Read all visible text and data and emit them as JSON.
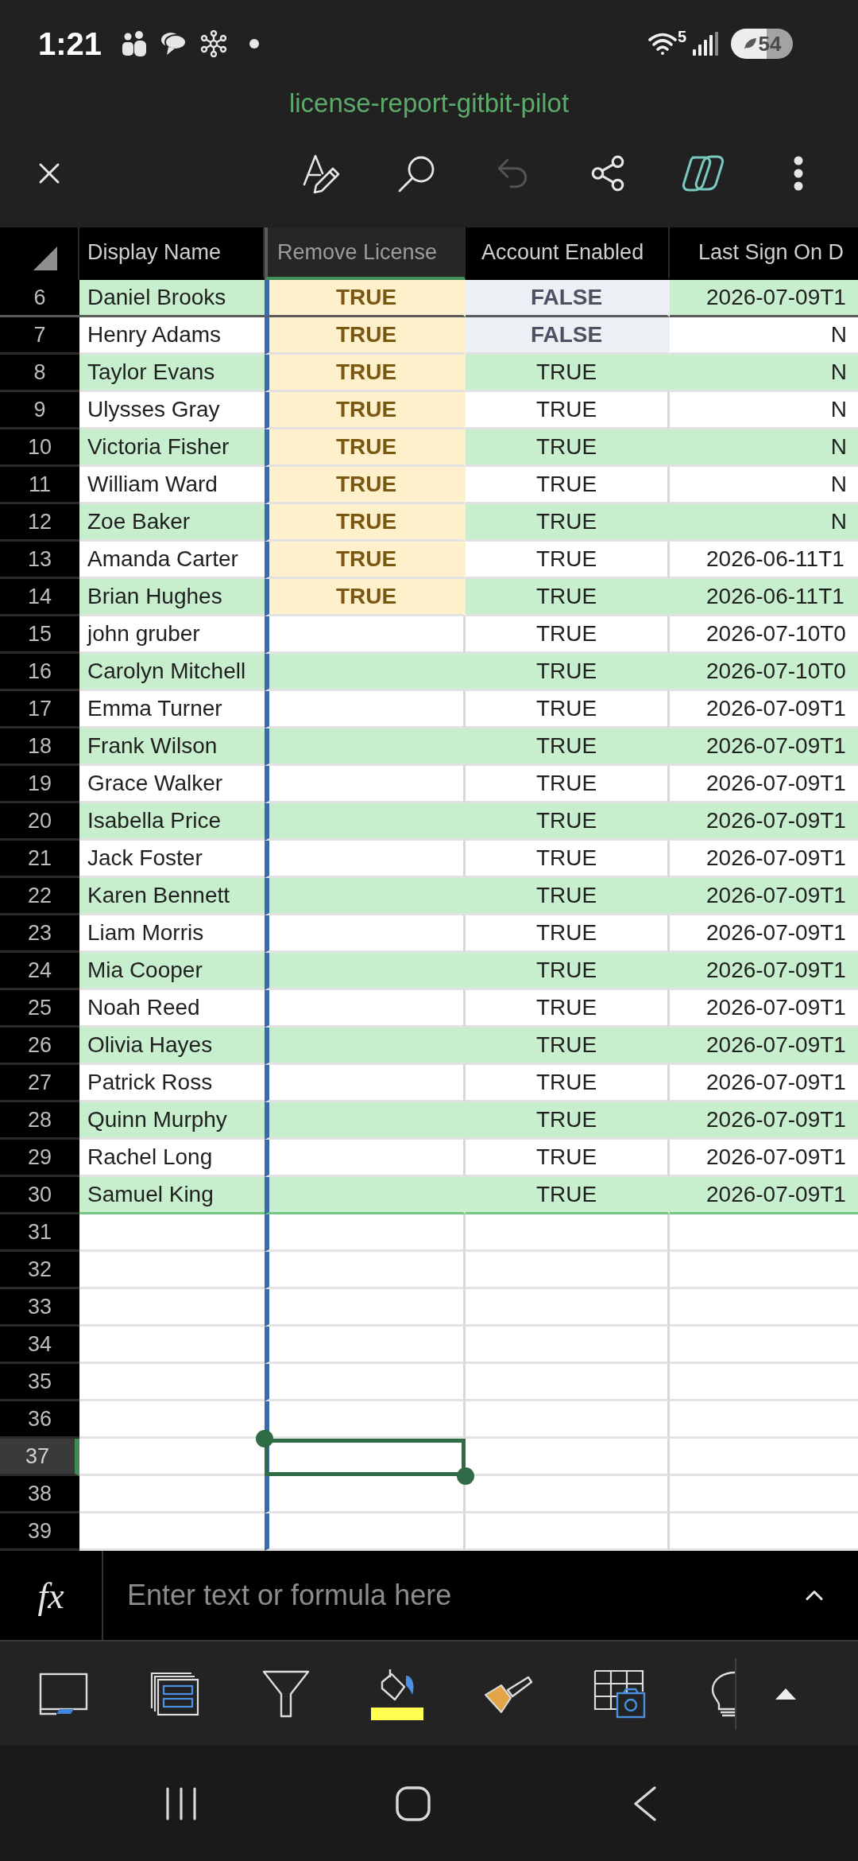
{
  "status_bar": {
    "time": "1:21",
    "wifi_label": "5",
    "battery": "54"
  },
  "title": "license-report-gitbit-pilot",
  "toolbar": [
    {
      "kind": "edit",
      "disabled": false
    },
    {
      "kind": "search",
      "disabled": false
    },
    {
      "kind": "undo",
      "disabled": true
    },
    {
      "kind": "share",
      "disabled": false
    },
    {
      "kind": "assistant",
      "disabled": false
    },
    {
      "kind": "more",
      "disabled": false
    }
  ],
  "table": {
    "columns": [
      {
        "label": "Display Name",
        "selected": false
      },
      {
        "label": "Remove License",
        "selected": true
      },
      {
        "label": "Account Enabled",
        "selected": false
      },
      {
        "label": "Last Sign On D",
        "selected": false
      }
    ],
    "frozen_rows": [
      {
        "number": "6",
        "selected": false,
        "banded": true,
        "cells": [
          {
            "text": "Daniel Brooks",
            "kind": "name"
          },
          {
            "text": "TRUE",
            "kind": "highlight"
          },
          {
            "text": "FALSE",
            "kind": "muted"
          },
          {
            "text": "2026-07-09T1",
            "kind": "date"
          }
        ]
      }
    ],
    "rows": [
      {
        "number": "7",
        "selected": false,
        "banded": false,
        "cells": [
          {
            "text": "Henry Adams",
            "kind": "name"
          },
          {
            "text": "TRUE",
            "kind": "highlight"
          },
          {
            "text": "FALSE",
            "kind": "muted"
          },
          {
            "text": "N",
            "kind": "status"
          }
        ]
      },
      {
        "number": "8",
        "selected": false,
        "banded": true,
        "cells": [
          {
            "text": "Taylor Evans",
            "kind": "name"
          },
          {
            "text": "TRUE",
            "kind": "highlight"
          },
          {
            "text": "TRUE",
            "kind": "bool"
          },
          {
            "text": "N",
            "kind": "status"
          }
        ]
      },
      {
        "number": "9",
        "selected": false,
        "banded": false,
        "cells": [
          {
            "text": "Ulysses Gray",
            "kind": "name"
          },
          {
            "text": "TRUE",
            "kind": "highlight"
          },
          {
            "text": "TRUE",
            "kind": "bool"
          },
          {
            "text": "N",
            "kind": "status"
          }
        ]
      },
      {
        "number": "10",
        "selected": false,
        "banded": true,
        "cells": [
          {
            "text": "Victoria Fisher",
            "kind": "name"
          },
          {
            "text": "TRUE",
            "kind": "highlight"
          },
          {
            "text": "TRUE",
            "kind": "bool"
          },
          {
            "text": "N",
            "kind": "status"
          }
        ]
      },
      {
        "number": "11",
        "selected": false,
        "banded": false,
        "cells": [
          {
            "text": "William Ward",
            "kind": "name"
          },
          {
            "text": "TRUE",
            "kind": "highlight"
          },
          {
            "text": "TRUE",
            "kind": "bool"
          },
          {
            "text": "N",
            "kind": "status"
          }
        ]
      },
      {
        "number": "12",
        "selected": false,
        "banded": true,
        "cells": [
          {
            "text": "Zoe Baker",
            "kind": "name"
          },
          {
            "text": "TRUE",
            "kind": "highlight"
          },
          {
            "text": "TRUE",
            "kind": "bool"
          },
          {
            "text": "N",
            "kind": "status"
          }
        ]
      },
      {
        "number": "13",
        "selected": false,
        "banded": false,
        "cells": [
          {
            "text": "Amanda Carter",
            "kind": "name"
          },
          {
            "text": "TRUE",
            "kind": "highlight"
          },
          {
            "text": "TRUE",
            "kind": "bool"
          },
          {
            "text": "2026-06-11T1",
            "kind": "date"
          }
        ]
      },
      {
        "number": "14",
        "selected": false,
        "banded": true,
        "cells": [
          {
            "text": "Brian Hughes",
            "kind": "name"
          },
          {
            "text": "TRUE",
            "kind": "highlight"
          },
          {
            "text": "TRUE",
            "kind": "bool"
          },
          {
            "text": "2026-06-11T1",
            "kind": "date"
          }
        ]
      },
      {
        "number": "15",
        "selected": false,
        "banded": false,
        "cells": [
          {
            "text": "john gruber",
            "kind": "name"
          },
          {
            "kind": "blank"
          },
          {
            "text": "TRUE",
            "kind": "bool"
          },
          {
            "text": "2026-07-10T0",
            "kind": "date"
          }
        ]
      },
      {
        "number": "16",
        "selected": false,
        "banded": true,
        "cells": [
          {
            "text": "Carolyn Mitchell",
            "kind": "name"
          },
          {
            "kind": "blank"
          },
          {
            "text": "TRUE",
            "kind": "bool"
          },
          {
            "text": "2026-07-10T0",
            "kind": "date"
          }
        ]
      },
      {
        "number": "17",
        "selected": false,
        "banded": false,
        "cells": [
          {
            "text": "Emma Turner",
            "kind": "name"
          },
          {
            "kind": "blank"
          },
          {
            "text": "TRUE",
            "kind": "bool"
          },
          {
            "text": "2026-07-09T1",
            "kind": "date"
          }
        ]
      },
      {
        "number": "18",
        "selected": false,
        "banded": true,
        "cells": [
          {
            "text": "Frank Wilson",
            "kind": "name"
          },
          {
            "kind": "blank"
          },
          {
            "text": "TRUE",
            "kind": "bool"
          },
          {
            "text": "2026-07-09T1",
            "kind": "date"
          }
        ]
      },
      {
        "number": "19",
        "selected": false,
        "banded": false,
        "cells": [
          {
            "text": "Grace Walker",
            "kind": "name"
          },
          {
            "kind": "blank"
          },
          {
            "text": "TRUE",
            "kind": "bool"
          },
          {
            "text": "2026-07-09T1",
            "kind": "date"
          }
        ]
      },
      {
        "number": "20",
        "selected": false,
        "banded": true,
        "cells": [
          {
            "text": "Isabella Price",
            "kind": "name"
          },
          {
            "kind": "blank"
          },
          {
            "text": "TRUE",
            "kind": "bool"
          },
          {
            "text": "2026-07-09T1",
            "kind": "date"
          }
        ]
      },
      {
        "number": "21",
        "selected": false,
        "banded": false,
        "cells": [
          {
            "text": "Jack Foster",
            "kind": "name"
          },
          {
            "kind": "blank"
          },
          {
            "text": "TRUE",
            "kind": "bool"
          },
          {
            "text": "2026-07-09T1",
            "kind": "date"
          }
        ]
      },
      {
        "number": "22",
        "selected": false,
        "banded": true,
        "cells": [
          {
            "text": "Karen Bennett",
            "kind": "name"
          },
          {
            "kind": "blank"
          },
          {
            "text": "TRUE",
            "kind": "bool"
          },
          {
            "text": "2026-07-09T1",
            "kind": "date"
          }
        ]
      },
      {
        "number": "23",
        "selected": false,
        "banded": false,
        "cells": [
          {
            "text": "Liam Morris",
            "kind": "name"
          },
          {
            "kind": "blank"
          },
          {
            "text": "TRUE",
            "kind": "bool"
          },
          {
            "text": "2026-07-09T1",
            "kind": "date"
          }
        ]
      },
      {
        "number": "24",
        "selected": false,
        "banded": true,
        "cells": [
          {
            "text": "Mia Cooper",
            "kind": "name"
          },
          {
            "kind": "blank"
          },
          {
            "text": "TRUE",
            "kind": "bool"
          },
          {
            "text": "2026-07-09T1",
            "kind": "date"
          }
        ]
      },
      {
        "number": "25",
        "selected": false,
        "banded": false,
        "cells": [
          {
            "text": "Noah Reed",
            "kind": "name"
          },
          {
            "kind": "blank"
          },
          {
            "text": "TRUE",
            "kind": "bool"
          },
          {
            "text": "2026-07-09T1",
            "kind": "date"
          }
        ]
      },
      {
        "number": "26",
        "selected": false,
        "banded": true,
        "cells": [
          {
            "text": "Olivia Hayes",
            "kind": "name"
          },
          {
            "kind": "blank"
          },
          {
            "text": "TRUE",
            "kind": "bool"
          },
          {
            "text": "2026-07-09T1",
            "kind": "date"
          }
        ]
      },
      {
        "number": "27",
        "selected": false,
        "banded": false,
        "cells": [
          {
            "text": "Patrick Ross",
            "kind": "name"
          },
          {
            "kind": "blank"
          },
          {
            "text": "TRUE",
            "kind": "bool"
          },
          {
            "text": "2026-07-09T1",
            "kind": "date"
          }
        ]
      },
      {
        "number": "28",
        "selected": false,
        "banded": true,
        "cells": [
          {
            "text": "Quinn Murphy",
            "kind": "name"
          },
          {
            "kind": "blank"
          },
          {
            "text": "TRUE",
            "kind": "bool"
          },
          {
            "text": "2026-07-09T1",
            "kind": "date"
          }
        ]
      },
      {
        "number": "29",
        "selected": false,
        "banded": false,
        "cells": [
          {
            "text": "Rachel Long",
            "kind": "name"
          },
          {
            "kind": "blank"
          },
          {
            "text": "TRUE",
            "kind": "bool"
          },
          {
            "text": "2026-07-09T1",
            "kind": "date"
          }
        ]
      },
      {
        "number": "30",
        "selected": false,
        "banded": true,
        "cells": [
          {
            "text": "Samuel King",
            "kind": "name"
          },
          {
            "kind": "blank"
          },
          {
            "text": "TRUE",
            "kind": "bool"
          },
          {
            "text": "2026-07-09T1",
            "kind": "date"
          }
        ]
      },
      {
        "number": "31",
        "selected": false,
        "banded": false
      },
      {
        "number": "32",
        "selected": false,
        "banded": false
      },
      {
        "number": "33",
        "selected": false,
        "banded": false
      },
      {
        "number": "34",
        "selected": false,
        "banded": false
      },
      {
        "number": "35",
        "selected": false,
        "banded": false
      },
      {
        "number": "36",
        "selected": false,
        "banded": false
      },
      {
        "number": "37",
        "selected": true,
        "banded": false
      },
      {
        "number": "38",
        "selected": false,
        "banded": false
      },
      {
        "number": "39",
        "selected": false,
        "banded": false
      }
    ]
  },
  "formula_bar": {
    "label": "fx",
    "placeholder": "Enter text or formula here"
  }
}
